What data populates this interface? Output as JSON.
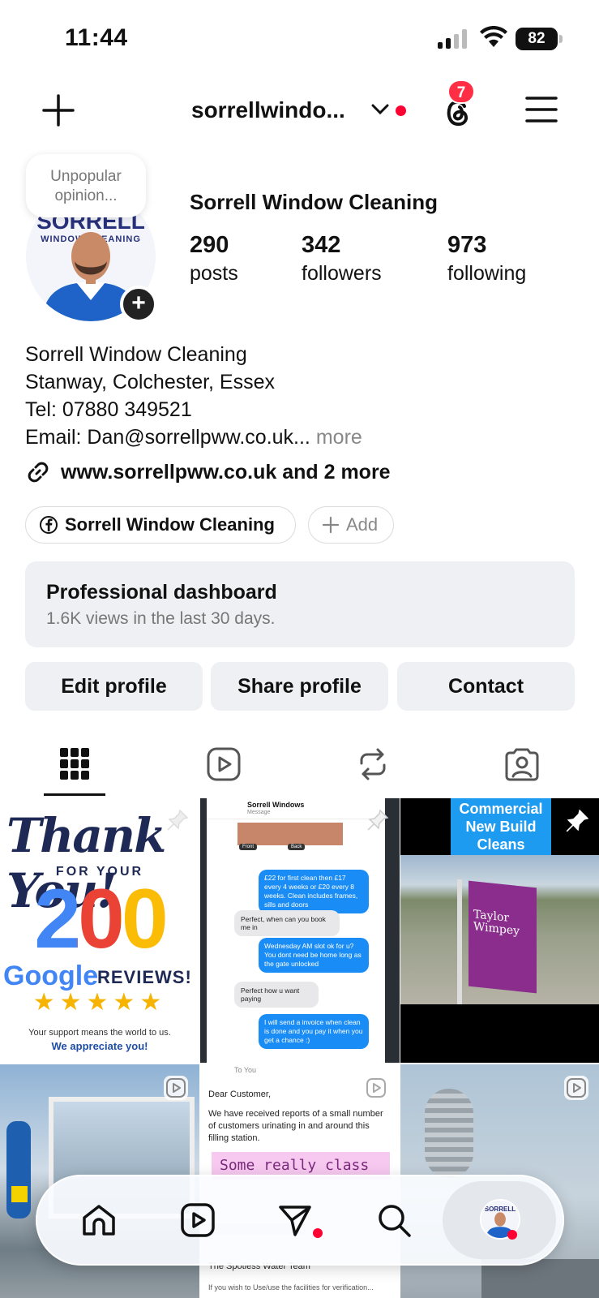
{
  "status_bar": {
    "time": "11:44",
    "battery": "82"
  },
  "header": {
    "username": "sorrellwindo...",
    "notification_count": "7"
  },
  "profile": {
    "note": "Unpopular opinion...",
    "display_name": "Sorrell Window Cleaning",
    "stats": [
      {
        "value": "290",
        "label": "posts"
      },
      {
        "value": "342",
        "label": "followers"
      },
      {
        "value": "973",
        "label": "following"
      }
    ],
    "bio_lines": [
      "Sorrell Window Cleaning",
      "Stanway, Colchester, Essex",
      "Tel: 07880 349521",
      "Email: Dan@sorrellpww.co.uk..."
    ],
    "bio_more": "more",
    "link": "www.sorrellpww.co.uk and 2 more",
    "chips": {
      "facebook": "Sorrell Window Cleaning",
      "add": "Add"
    },
    "avatar_text": {
      "top": "SORRELL",
      "sub": "WINDOW CLEANING"
    }
  },
  "dashboard": {
    "title": "Professional dashboard",
    "subtitle": "1.6K views in the last 30 days."
  },
  "actions": {
    "edit": "Edit profile",
    "share": "Share profile",
    "contact": "Contact"
  },
  "posts": {
    "thankyou": {
      "title": "Thank You!",
      "for_your": "FOR YOUR",
      "number": "200",
      "google": "Google",
      "reviews": "REVIEWS!",
      "stars": "★★★★★",
      "support": "Your support means the world to us.",
      "appreciate": "We appreciate you!"
    },
    "chat": {
      "contact": "Sorrell Windows",
      "subtitle": "Message",
      "msg1": "£22 for first clean then £17 every 4 weeks or £20 every 8 weeks. Clean includes frames, sills and doors",
      "msg2": "Perfect, when can you book me in",
      "msg3": "Wednesday AM slot ok for u? You dont need be home long as the gate unlocked",
      "msg4": "Perfect how u want paying",
      "msg5": "I will send a invoice when clean is done and you pay it when you get a chance :)",
      "house_labels": [
        "Front",
        "Back"
      ]
    },
    "commercial": {
      "banner": "Commercial New Build Cleans",
      "flag": "Taylor Wimpey"
    },
    "letter": {
      "to": "To You",
      "greeting": "Dear Customer,",
      "body": "We have received reports of a small number of customers urinating in and around this filling station.",
      "highlight": "Some really class",
      "sign": "The Spotless Water Team",
      "footer": "If you wish to Use/use the facilities for verification..."
    }
  },
  "colors": {
    "accent_red": "#ff0033",
    "chip_bg": "#eef0f3",
    "google_blue": "#4285f4",
    "google_red": "#ea4335",
    "google_yellow": "#fbbc05",
    "google_green": "#34a853"
  }
}
